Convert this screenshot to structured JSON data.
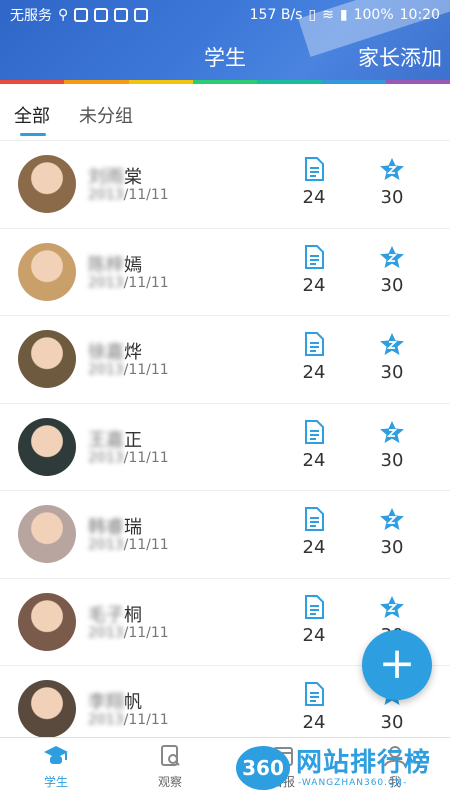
{
  "status_bar": {
    "carrier": "无服务",
    "speed": "157 B/s",
    "battery": "100%",
    "time": "10:20"
  },
  "header": {
    "title": "学生",
    "action": "家长添加",
    "rainbow_colors": [
      "#e74c3c",
      "#f39c12",
      "#f1c40f",
      "#2ecc71",
      "#1abc9c",
      "#3498db",
      "#9b59b6"
    ]
  },
  "tabs": [
    "全部",
    "未分组"
  ],
  "students": [
    {
      "name_visible": "棠",
      "name_hidden": "刘雨",
      "date_hidden": "2013",
      "date_visible": "/11/11",
      "docs": "24",
      "stars": "30",
      "avatar_color": "#8b6a4a"
    },
    {
      "name_visible": "嫣",
      "name_hidden": "陈梓",
      "date_hidden": "2013",
      "date_visible": "/11/11",
      "docs": "24",
      "stars": "30",
      "avatar_color": "#c9a06a"
    },
    {
      "name_visible": "烨",
      "name_hidden": "徐嘉",
      "date_hidden": "2013",
      "date_visible": "/11/11",
      "docs": "24",
      "stars": "30",
      "avatar_color": "#6e5a3e"
    },
    {
      "name_visible": "正",
      "name_hidden": "王嘉",
      "date_hidden": "2013",
      "date_visible": "/11/11",
      "docs": "24",
      "stars": "30",
      "avatar_color": "#2f3b3a"
    },
    {
      "name_visible": "瑞",
      "name_hidden": "韩睿",
      "date_hidden": "2013",
      "date_visible": "/11/11",
      "docs": "24",
      "stars": "30",
      "avatar_color": "#b8a5a0"
    },
    {
      "name_visible": "桐",
      "name_hidden": "毛子",
      "date_hidden": "2013",
      "date_visible": "/11/11",
      "docs": "24",
      "stars": "30",
      "avatar_color": "#7a5a4a"
    },
    {
      "name_visible": "帆",
      "name_hidden": "李翔",
      "date_hidden": "2013",
      "date_visible": "/11/11",
      "docs": "24",
      "stars": "30",
      "avatar_color": "#5a4a3e"
    }
  ],
  "fab_label": "+",
  "bottom_nav": [
    {
      "label": "学生",
      "icon": "graduation-cap-icon"
    },
    {
      "label": "观察",
      "icon": "notebook-search-icon"
    },
    {
      "label": "日报",
      "icon": "calendar-icon"
    },
    {
      "label": "我",
      "icon": "person-icon"
    }
  ],
  "watermark": {
    "logo": "360",
    "title": "网站排行榜",
    "subtitle": "-WANGZHAN360.CN-"
  },
  "colors": {
    "accent": "#2d9ee0",
    "header": "#3d78d8"
  }
}
